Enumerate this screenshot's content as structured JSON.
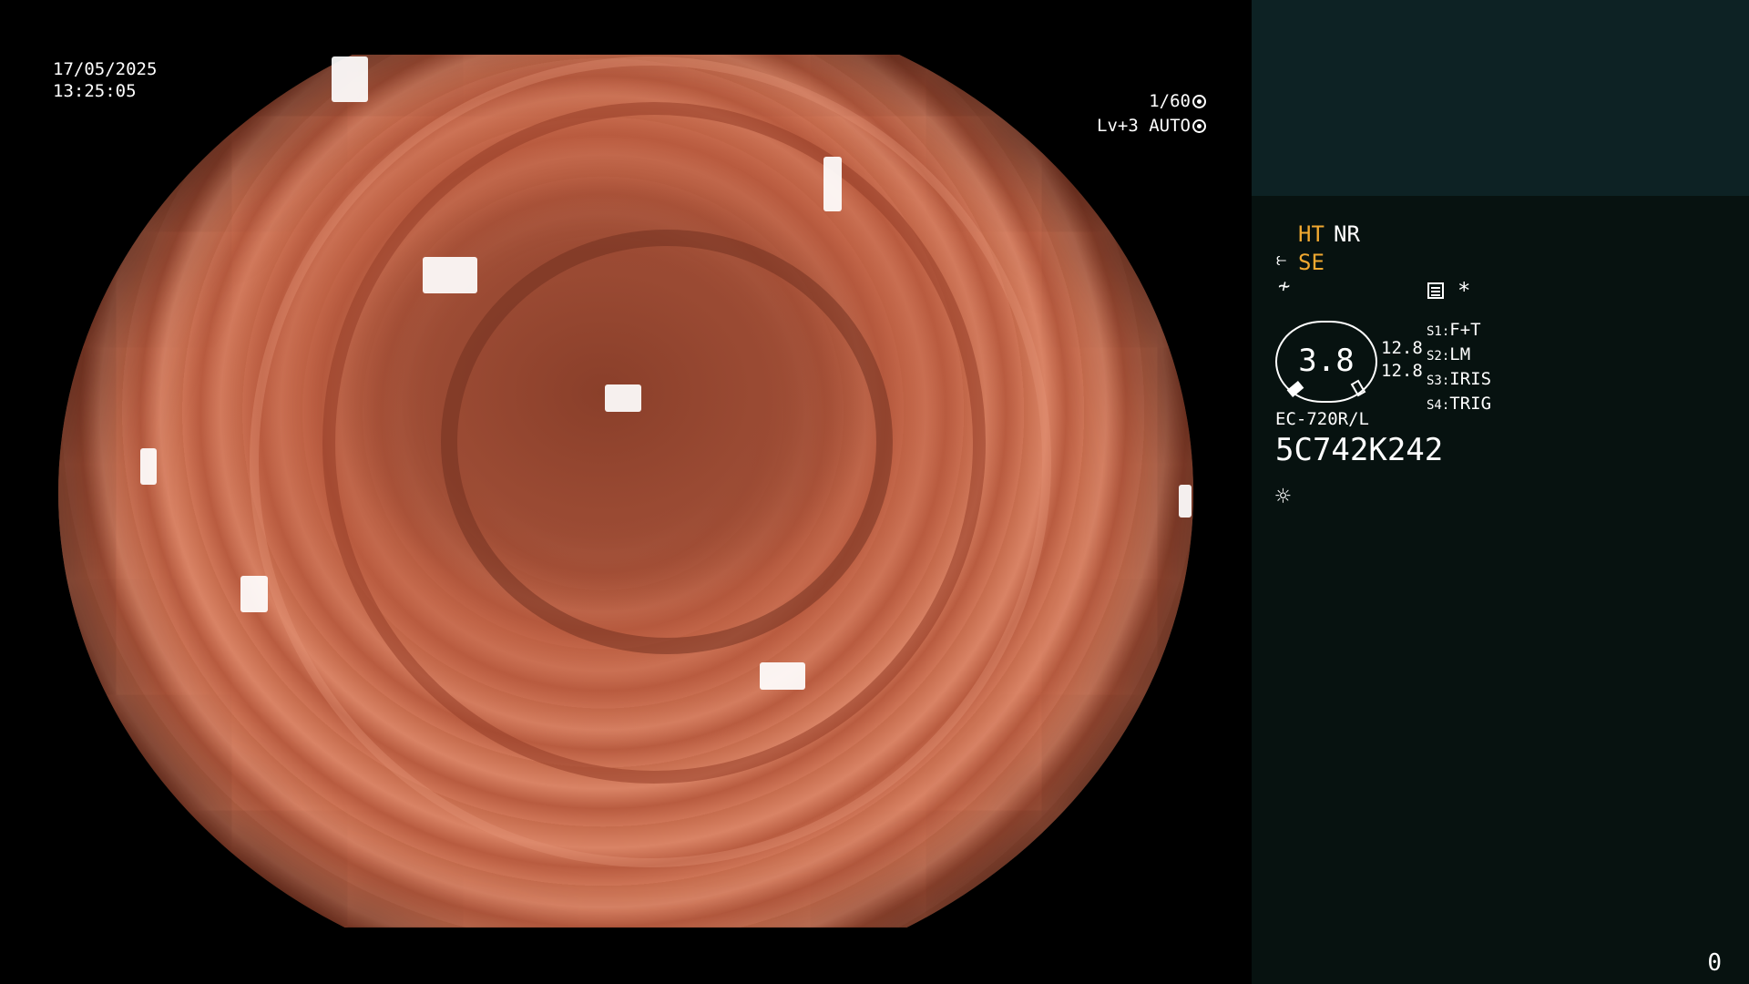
{
  "overlay": {
    "date": "17/05/2025",
    "time": "13:25:05",
    "shutter": "1/60",
    "level_mode": "Lv+3 AUTO"
  },
  "panel": {
    "mode_ht": "HT",
    "mode_nr": "NR",
    "mode_se": "SE",
    "asterisk": "*",
    "gauge_value": "3.8",
    "level_1": "12.8",
    "level_2": "12.8",
    "settings": [
      {
        "key": "S1:",
        "value": "F+T"
      },
      {
        "key": "S2:",
        "value": "LM"
      },
      {
        "key": "S3:",
        "value": "IRIS"
      },
      {
        "key": "S4:",
        "value": "TRIG"
      }
    ],
    "scope_model": "EC-720R/L",
    "serial": "5C742K242",
    "corner_counter": "0"
  },
  "icons": [
    "aperture-icon",
    "iris-icon",
    "pump-icon",
    "contrast-icon",
    "memo-icon",
    "light-icon"
  ],
  "colors": {
    "accent_orange": "#f0a830",
    "panel_top": "#0d2224",
    "panel_bg": "#071210",
    "tissue": "#c4694b"
  }
}
